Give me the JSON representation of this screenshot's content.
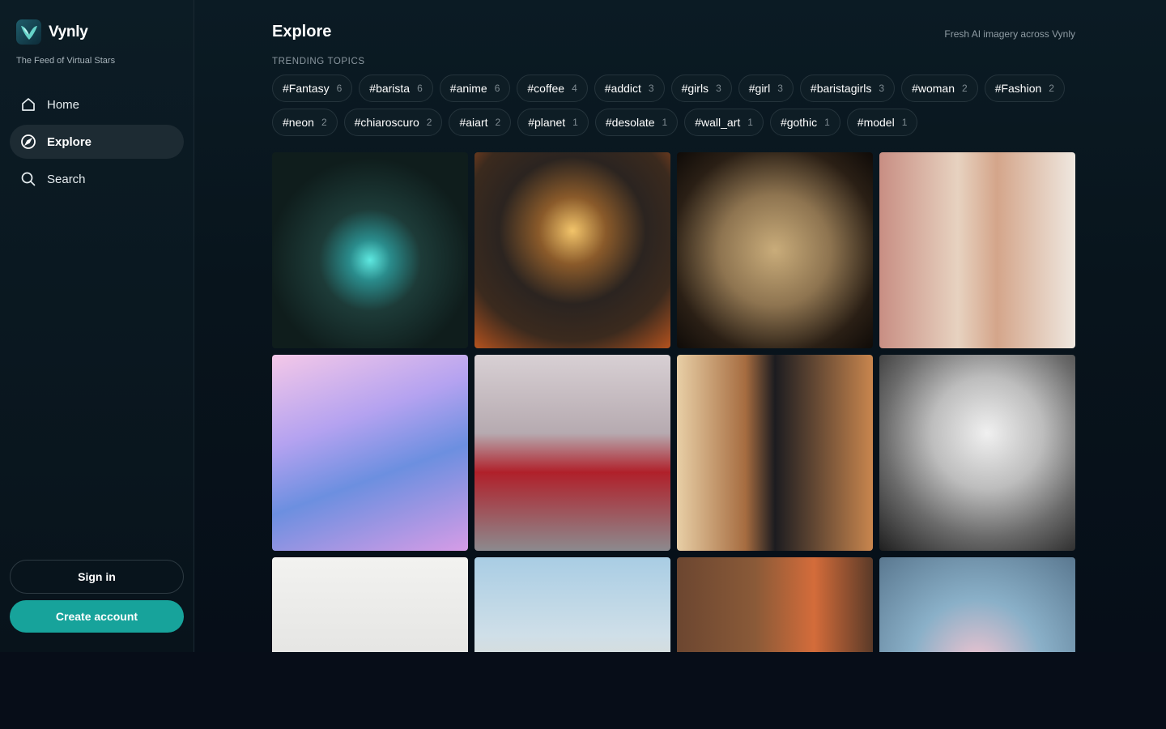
{
  "brand": {
    "name": "Vynly",
    "tagline": "The Feed of Virtual Stars"
  },
  "nav": [
    {
      "label": "Home",
      "icon": "home-icon"
    },
    {
      "label": "Explore",
      "icon": "compass-icon",
      "active": true
    },
    {
      "label": "Search",
      "icon": "search-icon"
    }
  ],
  "auth": {
    "signin": "Sign in",
    "create": "Create account"
  },
  "page": {
    "title": "Explore",
    "subtitle": "Fresh AI imagery across Vynly",
    "trending_label": "TRENDING TOPICS"
  },
  "tags_row1": [
    {
      "tag": "#Fantasy",
      "count": "6"
    },
    {
      "tag": "#barista",
      "count": "6"
    },
    {
      "tag": "#anime",
      "count": "6"
    },
    {
      "tag": "#coffee",
      "count": "4"
    },
    {
      "tag": "#addict",
      "count": "3"
    },
    {
      "tag": "#girls",
      "count": "3"
    },
    {
      "tag": "#girl",
      "count": "3"
    },
    {
      "tag": "#baristagirls",
      "count": "3"
    },
    {
      "tag": "#woman",
      "count": "2"
    },
    {
      "tag": "#Fashion",
      "count": "2"
    }
  ],
  "tags_row2": [
    {
      "tag": "#neon",
      "count": "2"
    },
    {
      "tag": "#chiaroscuro",
      "count": "2"
    },
    {
      "tag": "#aiart",
      "count": "2"
    },
    {
      "tag": "#planet",
      "count": "1"
    },
    {
      "tag": "#desolate",
      "count": "1"
    },
    {
      "tag": "#wall_art",
      "count": "1"
    },
    {
      "tag": "#gothic",
      "count": "1"
    },
    {
      "tag": "#model",
      "count": "1"
    }
  ],
  "colors": {
    "accent": "#17a39b",
    "background": "#070d18",
    "tag_bg": "#0e1d25"
  },
  "gallery": [
    {
      "name": "glowing-butterfly-mushroom-image",
      "g": "radial-gradient(circle at 50% 55%, #5ee8e0 0%, #2a8c8c 14%, #1d3b38 35%, #0f1d1c 70%)"
    },
    {
      "name": "winged-hooded-figure-image",
      "g": "radial-gradient(circle at 50% 40%, #f2c46a 0%, #8a5a2a 22%, #2b2420 48%, #3b2a1e 72%, #b4521e 100%)"
    },
    {
      "name": "gothic-butterfly-woman-image",
      "g": "radial-gradient(ellipse at 50% 50%, #c9ac7a 0%, #8e7450 40%, #2a1f15 75%, #0f0b08 100%)"
    },
    {
      "name": "blonde-woman-sunglasses-image",
      "g": "linear-gradient(90deg, #c88e83 0%, #e7d2c0 40%, #d4a58a 60%, #efe8e0 100%)"
    },
    {
      "name": "underwater-mermaid-image",
      "g": "linear-gradient(160deg, #f4c8e8 0%, #b4a2f0 35%, #6c8fe0 60%, #d69ce6 100%)"
    },
    {
      "name": "samurai-girl-red-image",
      "g": "linear-gradient(180deg, #d8d0d4 0%, #b6aab0 40%, #b0202a 60%, #8c8a8e 100%)"
    },
    {
      "name": "barista-anime-black-outfit-image",
      "g": "linear-gradient(90deg, #e8cfa6 0%, #a66c40 35%, #1c1c20 50%, #c9864e 100%)"
    },
    {
      "name": "hooded-woman-monochrome-image",
      "g": "radial-gradient(circle at 55% 40%, #f0f0f0 0%, #bdbdbd 35%, #6b6b6b 65%, #1f1f1f 100%)"
    },
    {
      "name": "armored-soldier-rifle-image",
      "g": "linear-gradient(180deg, #f2f2f0 0%, #e4e4e2 55%, #2a3030 56%, #2a3030 100%)"
    },
    {
      "name": "clay-character-planet-image",
      "g": "linear-gradient(180deg, #a9cde4 0%, #cfdfe8 40%, #e3d8c8 70%, #e6a055 100%)"
    },
    {
      "name": "two-anime-girls-cafe-image",
      "g": "linear-gradient(90deg, #6c4630 0%, #8a5a38 40%, #d46c3a 70%, #5a3a28 100%)"
    },
    {
      "name": "flower-face-image",
      "g": "radial-gradient(circle at 50% 55%, #f2c4d0 0%, #8ab0c8 45%, #5a7890 100%)"
    }
  ]
}
